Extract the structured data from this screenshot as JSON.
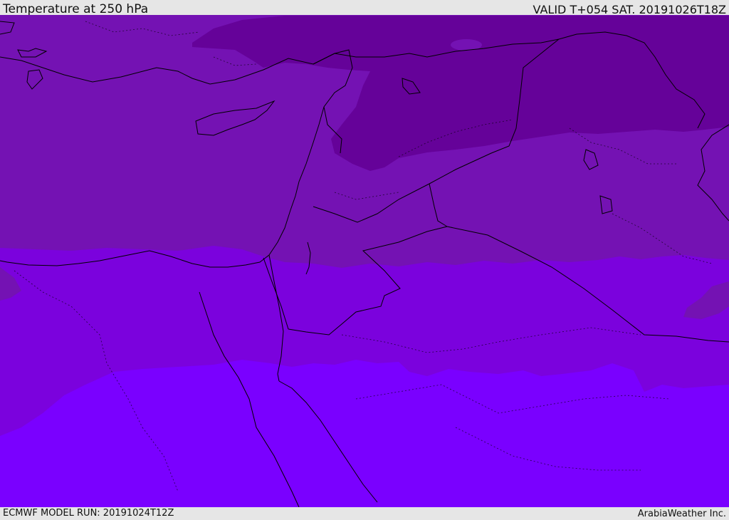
{
  "header": {
    "title": "Temperature at 250 hPa",
    "valid": "VALID T+054 SAT. 20191026T18Z"
  },
  "footer": {
    "model_run": "ECMWF MODEL RUN: 20191024T12Z",
    "brand": "ArabiaWeather Inc."
  },
  "map": {
    "region": "Eastern Mediterranean and Middle East",
    "field": "temperature",
    "level": "250 hPa",
    "colors": {
      "darkest": "#650299",
      "dark": "#7412b3",
      "mid": "#7b02dd",
      "bright": "#7a00ff",
      "border": "#000000"
    }
  }
}
